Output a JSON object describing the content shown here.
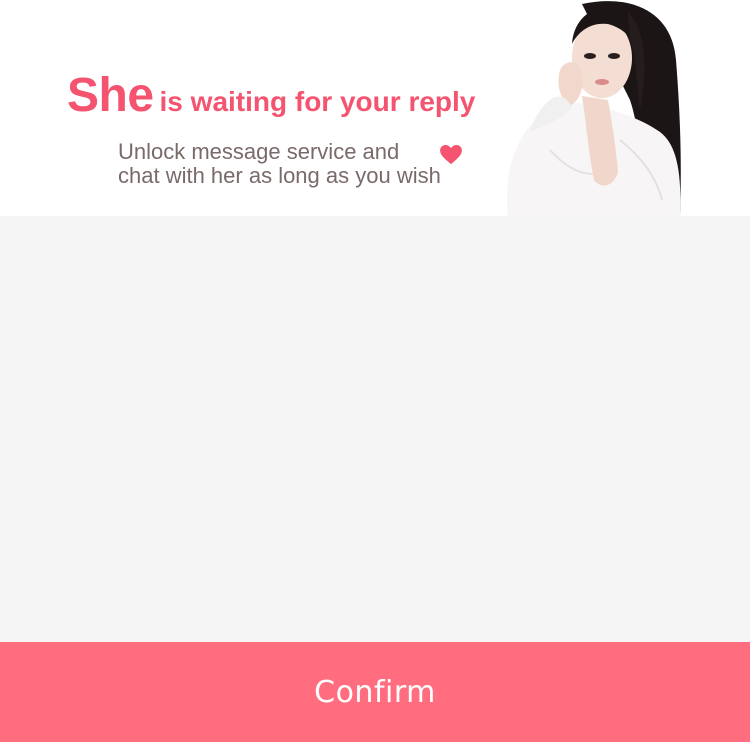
{
  "hero": {
    "title_big": "She",
    "title_rest": "is waiting for your reply",
    "subtitle_line1": "Unlock message service and",
    "subtitle_line2": "chat with her as long as you wish",
    "heart_icon": "heart-icon",
    "accent_color": "#f4546f"
  },
  "footer": {
    "confirm_label": "Confirm",
    "button_color": "#ff6d7f"
  }
}
